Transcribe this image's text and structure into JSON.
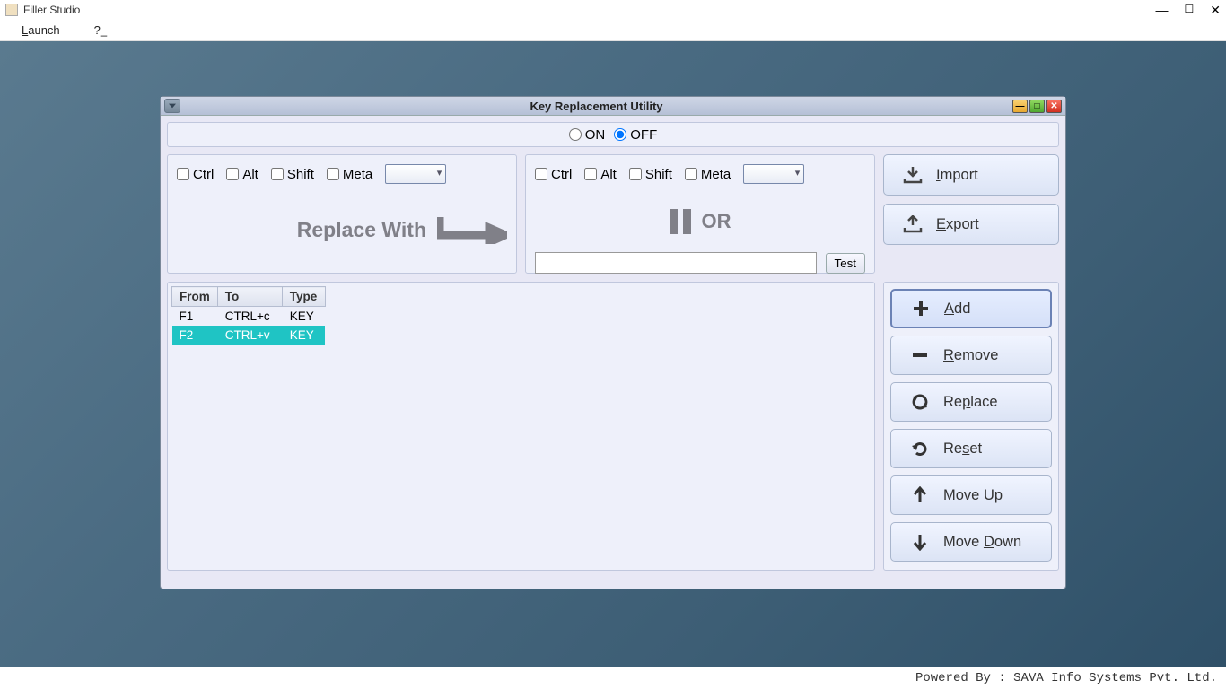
{
  "window": {
    "title": "Filler Studio"
  },
  "menubar": {
    "launch": "Launch",
    "help": "?_"
  },
  "dialog": {
    "title": "Key Replacement Utility",
    "on": "ON",
    "off": "OFF",
    "modifiers": {
      "ctrl": "Ctrl",
      "alt": "Alt",
      "shift": "Shift",
      "meta": "Meta"
    },
    "replace_with": "Replace With",
    "or": "OR",
    "test": "Test",
    "buttons": {
      "import": "Import",
      "export": "Export",
      "add": "Add",
      "remove": "Remove",
      "replace": "Replace",
      "reset": "Reset",
      "move_up": "Move Up",
      "move_down": "Move Down"
    },
    "table": {
      "headers": {
        "from": "From",
        "to": "To",
        "type": "Type"
      },
      "rows": [
        {
          "from": "F1",
          "to": "CTRL+c",
          "type": "KEY"
        },
        {
          "from": "F2",
          "to": "CTRL+v",
          "type": "KEY"
        }
      ]
    }
  },
  "statusbar": "Powered By : SAVA Info Systems Pvt. Ltd."
}
